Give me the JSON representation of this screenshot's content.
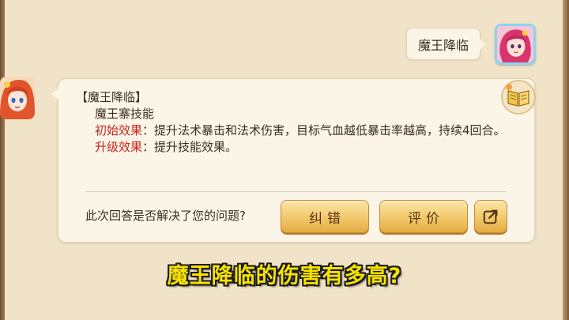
{
  "chat": {
    "user_message": "魔王降临",
    "answer": {
      "title_line": "【魔王降临】",
      "category_line": "魔王寨技能",
      "initial_label": "初始效果",
      "initial_text": "：提升法术暴击和法术伤害，目标气血越低暴击率越高，持续4回合。",
      "upgrade_label": "升级效果",
      "upgrade_text": "：提升技能效果。"
    },
    "feedback_question": "此次回答是否解决了您的问题?",
    "buttons": {
      "correct": "纠错",
      "rate": "评价"
    }
  },
  "subtitle": "魔王降临的伤害有多高?",
  "colors": {
    "background": "#f1e3c8",
    "bubble": "#fbf5e8",
    "label_red": "#c8241c",
    "button_gold": "#f2c86a",
    "subtitle_yellow": "#f6e200"
  },
  "icons": {
    "user_avatar": "pink-hair-character-avatar",
    "npc_avatar": "red-hair-girl-avatar",
    "book": "open-book-icon",
    "share": "share-arrow-icon"
  }
}
